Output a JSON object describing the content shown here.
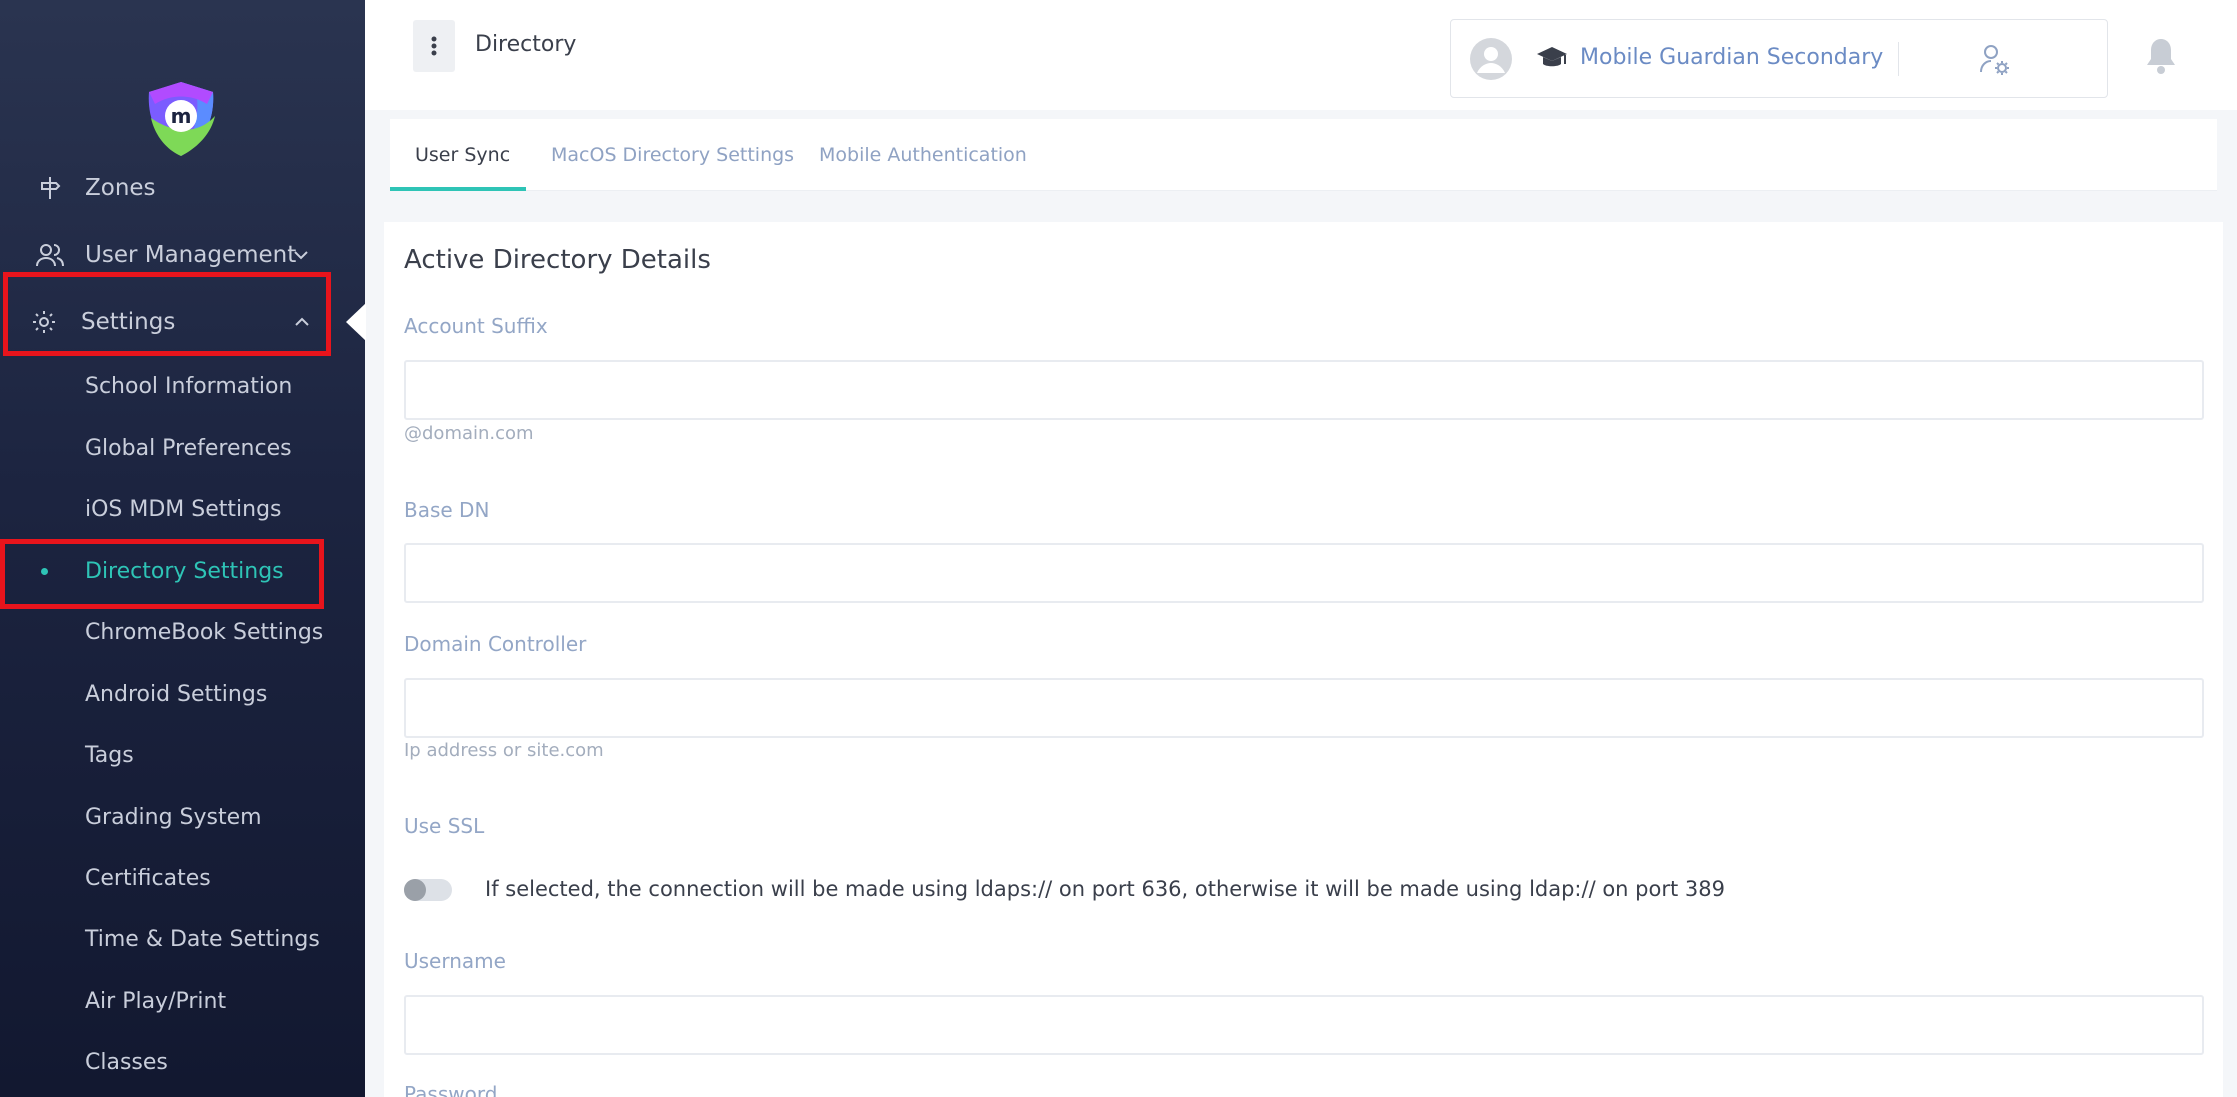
{
  "sidebar": {
    "items": [
      {
        "label": "Zones",
        "icon": "signpost-icon"
      },
      {
        "label": "User Management",
        "icon": "users-icon"
      },
      {
        "label": "Settings",
        "icon": "gear-icon"
      }
    ],
    "settings_submenu": [
      {
        "label": "School Information"
      },
      {
        "label": "Global Preferences"
      },
      {
        "label": "iOS MDM Settings"
      },
      {
        "label": "Directory Settings",
        "active": true
      },
      {
        "label": "ChromeBook Settings"
      },
      {
        "label": "Android Settings"
      },
      {
        "label": "Tags"
      },
      {
        "label": "Grading System"
      },
      {
        "label": "Certificates"
      },
      {
        "label": "Time & Date Settings"
      },
      {
        "label": "Air Play/Print"
      },
      {
        "label": "Classes"
      }
    ],
    "highlight_color": "#e8141c",
    "active_color": "#2ec4b6"
  },
  "header": {
    "title": "Directory",
    "org_name": "Mobile Guardian Secondary"
  },
  "tabs": [
    {
      "label": "User Sync",
      "active": true
    },
    {
      "label": "MacOS Directory Settings"
    },
    {
      "label": "Mobile Authentication"
    }
  ],
  "form": {
    "title": "Active Directory Details",
    "account_suffix": {
      "label": "Account Suffix",
      "value": "",
      "hint": "@domain.com"
    },
    "base_dn": {
      "label": "Base DN",
      "value": ""
    },
    "domain_controller": {
      "label": "Domain Controller",
      "value": "",
      "hint": "Ip address or site.com"
    },
    "use_ssl": {
      "label": "Use SSL",
      "enabled": false,
      "description": "If selected, the connection will be made using ldaps:// on port 636, otherwise it will be made using ldap:// on port 389"
    },
    "username": {
      "label": "Username",
      "value": ""
    },
    "password": {
      "label": "Password"
    }
  }
}
